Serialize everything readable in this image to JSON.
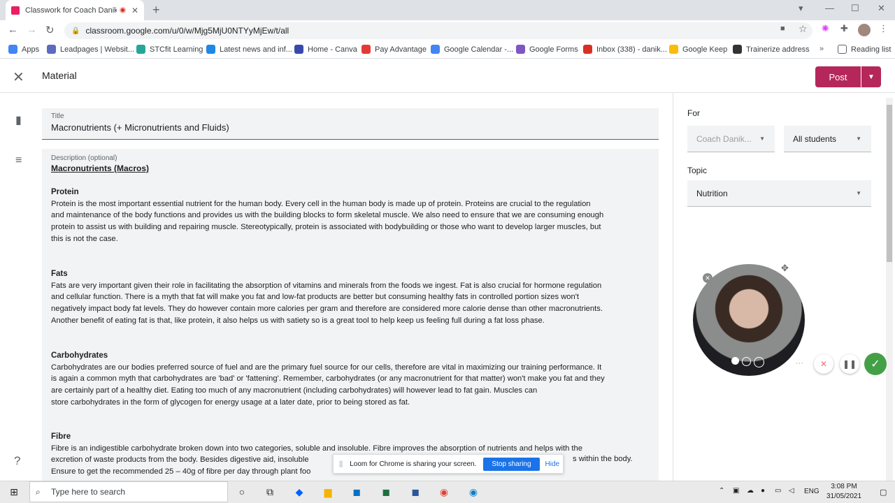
{
  "browser": {
    "tab_title": "Classwork for Coach Danika",
    "url": "classroom.google.com/u/0/w/Mjg5MjU0NTYyMjEw/t/all",
    "bookmarks": [
      {
        "label": "Apps",
        "color": "#4285f4"
      },
      {
        "label": "Leadpages | Websit...",
        "color": "#5c6bc0"
      },
      {
        "label": "STCfit Learning",
        "color": "#26a69a"
      },
      {
        "label": "Latest news and inf...",
        "color": "#1e88e5"
      },
      {
        "label": "Home - Canva",
        "color": "#3949ab"
      },
      {
        "label": "Pay Advantage",
        "color": "#e53935"
      },
      {
        "label": "Google Calendar -...",
        "color": "#4285f4"
      },
      {
        "label": "Google Forms",
        "color": "#7e57c2"
      },
      {
        "label": "Inbox (338) - danik...",
        "color": "#d93025"
      },
      {
        "label": "Google Keep",
        "color": "#fbbc04"
      },
      {
        "label": "Trainerize address",
        "color": "#333333"
      }
    ],
    "reading_list": "Reading list"
  },
  "header": {
    "title": "Material",
    "post_label": "Post"
  },
  "form": {
    "title_label": "Title",
    "title_value": "Macronutrients (+ Micronutrients and Fluids)",
    "description_label": "Description (optional)",
    "description_heading": "Macronutrients (Macros)",
    "sections": [
      {
        "heading": "Protein",
        "lines": [
          "Protein is the most important essential nutrient for the human body. Every cell in the human body is made up of protein. Proteins are crucial to the regulation",
          "and maintenance of the body functions and provides us with the building blocks to form skeletal muscle. We also need to ensure that we are consuming enough",
          "protein to assist us with building and repairing muscle. Stereotypically, protein is associated with bodybuilding or those who want to develop larger muscles, but",
          "this is not the case."
        ]
      },
      {
        "heading": "Fats",
        "lines": [
          "Fats are very important given their role in facilitating the absorption of vitamins and minerals from the foods we ingest. Fat is also crucial for hormone regulation",
          "and cellular function. There is a myth that fat will make you fat and low-fat products are better but consuming healthy fats in controlled portion sizes won't",
          "negatively impact body fat levels. They do however contain more calories per gram and therefore are considered more calorie dense than other macronutrients.",
          "Another benefit of eating fat is that, like protein, it also helps us with satiety so is a great tool to help keep us feeling full during a fat loss phase."
        ]
      },
      {
        "heading": "Carbohydrates",
        "lines": [
          "Carbohydrates are our bodies preferred source of fuel and are the primary fuel source for our cells, therefore are vital in maximizing our training performance. It",
          "is again a common myth that carbohydrates are 'bad' or 'fattening'. Remember, carbohydrates (or any macronutrient for that matter) won't make you fat and they",
          "are certainly part of a healthy diet. Eating too much of any macronutrient (including carbohydrates) will however lead to fat gain. Muscles can",
          "store carbohydrates in the form of glycogen for energy usage at a later date, prior to being stored as fat."
        ]
      },
      {
        "heading": "Fibre",
        "lines": [
          "Fibre is an indigestible carbohydrate broken down into two categories, soluble and insoluble. Fibre improves the absorption of nutrients and helps with the",
          "excretion of waste products from the body. Besides digestive aid, insoluble",
          "Ensure to get the recommended 25 – 40g of fibre per day through plant foo"
        ],
        "tail": "s within the body."
      }
    ]
  },
  "sidebar": {
    "for_label": "For",
    "class_value": "Coach Danik...",
    "students_value": "All students",
    "topic_label": "Topic",
    "topic_value": "Nutrition"
  },
  "loom": {
    "message": "Loom for Chrome is sharing your screen.",
    "stop_label": "Stop sharing",
    "hide_label": "Hide"
  },
  "taskbar": {
    "search_placeholder": "Type here to search",
    "lang": "ENG",
    "time": "3:08 PM",
    "date": "31/05/2021"
  },
  "colors": {
    "accent": "#b5275a",
    "loom_blue": "#1a73e8",
    "check_green": "#43a047"
  }
}
